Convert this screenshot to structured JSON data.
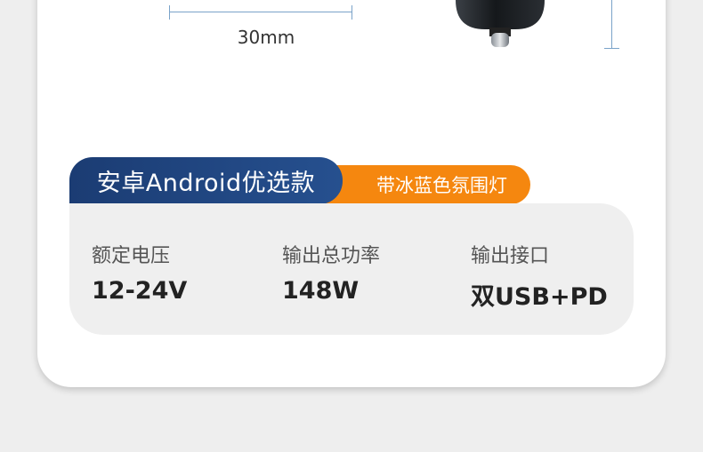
{
  "dimension": {
    "width_label": "30mm"
  },
  "badges": {
    "primary": "安卓Android优选款",
    "secondary": "带冰蓝色氛围灯"
  },
  "specs": [
    {
      "label": "额定电压",
      "value": "12-24V"
    },
    {
      "label": "输出总功率",
      "value": "148W"
    },
    {
      "label": "输出接口",
      "value": "双USB+PD"
    }
  ],
  "colors": {
    "badge_primary": "#1b3c73",
    "badge_secondary": "#f5870f",
    "dimension_line": "#7aa3c9",
    "panel": "#efefef"
  }
}
